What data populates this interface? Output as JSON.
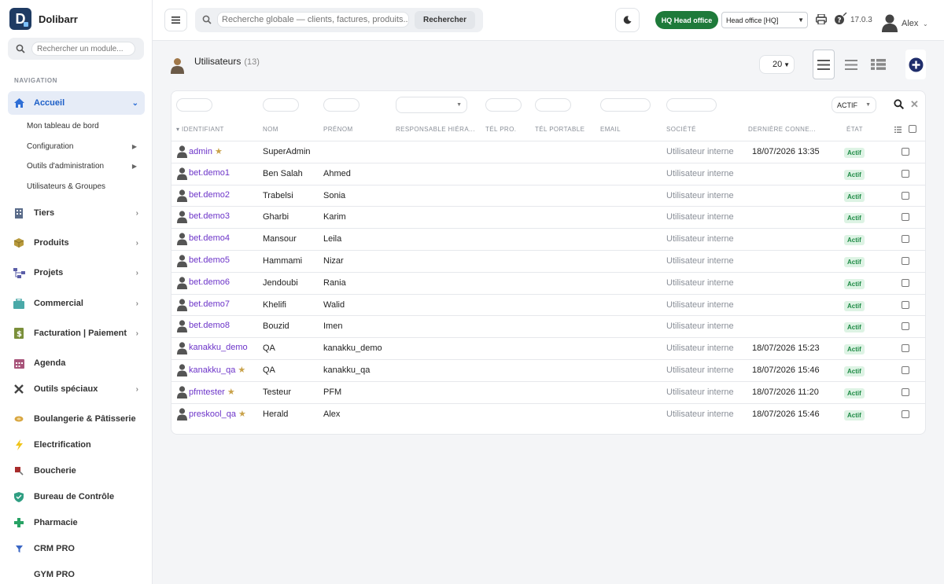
{
  "app": {
    "name": "Dolibarr"
  },
  "sidebar": {
    "search_placeholder": "Rechercher un module...",
    "nav_title": "NAVIGATION",
    "items": [
      {
        "label": "Accueil",
        "icon": "home-icon"
      },
      {
        "label": "Tiers",
        "icon": "building-icon"
      },
      {
        "label": "Produits",
        "icon": "box-icon"
      },
      {
        "label": "Projets",
        "icon": "project-icon"
      },
      {
        "label": "Commercial",
        "icon": "briefcase-icon"
      },
      {
        "label": "Facturation | Paiement",
        "icon": "invoice-icon"
      },
      {
        "label": "Agenda",
        "icon": "calendar-icon"
      },
      {
        "label": "Outils spéciaux",
        "icon": "tools-icon"
      },
      {
        "label": "Boulangerie & Pâtisserie",
        "icon": "bread-icon"
      },
      {
        "label": "Electrification",
        "icon": "lightning-icon"
      },
      {
        "label": "Boucherie",
        "icon": "meat-icon"
      },
      {
        "label": "Bureau de Contrôle",
        "icon": "shield-icon"
      },
      {
        "label": "Pharmacie",
        "icon": "cross-icon"
      },
      {
        "label": "CRM PRO",
        "icon": "funnel-icon"
      },
      {
        "label": "GYM PRO",
        "icon": "gym-icon"
      }
    ],
    "subitems": [
      {
        "label": "Mon tableau de bord"
      },
      {
        "label": "Configuration"
      },
      {
        "label": "Outils d'administration"
      },
      {
        "label": "Utilisateurs & Groupes"
      }
    ]
  },
  "topbar": {
    "search_placeholder": "Recherche globale — clients, factures, produits...",
    "search_button": "Rechercher",
    "entity_badge": "HQ Head office",
    "entity_select": "Head office [HQ]",
    "version": "17.0.3",
    "user": "Alex"
  },
  "page": {
    "title": "Utilisateurs",
    "count": "(13)",
    "limit": "20",
    "status_filter": "ACTIF"
  },
  "table": {
    "columns": [
      "IDENTIFIANT",
      "NOM",
      "PRÉNOM",
      "RESPONSABLE HIÉRA...",
      "TÉL PRO.",
      "TÉL PORTABLE",
      "EMAIL",
      "SOCIÉTÉ",
      "DERNIÈRE CONNE...",
      "ÉTAT"
    ],
    "rows": [
      {
        "login": "admin",
        "star": "★",
        "nom": "SuperAdmin",
        "prenom": "",
        "societe": "Utilisateur interne",
        "last": "18/07/2026 13:35",
        "etat": "Actif"
      },
      {
        "login": "bet.demo1",
        "star": "",
        "nom": "Ben Salah",
        "prenom": "Ahmed",
        "societe": "Utilisateur interne",
        "last": "",
        "etat": "Actif"
      },
      {
        "login": "bet.demo2",
        "star": "",
        "nom": "Trabelsi",
        "prenom": "Sonia",
        "societe": "Utilisateur interne",
        "last": "",
        "etat": "Actif"
      },
      {
        "login": "bet.demo3",
        "star": "",
        "nom": "Gharbi",
        "prenom": "Karim",
        "societe": "Utilisateur interne",
        "last": "",
        "etat": "Actif"
      },
      {
        "login": "bet.demo4",
        "star": "",
        "nom": "Mansour",
        "prenom": "Leila",
        "societe": "Utilisateur interne",
        "last": "",
        "etat": "Actif"
      },
      {
        "login": "bet.demo5",
        "star": "",
        "nom": "Hammami",
        "prenom": "Nizar",
        "societe": "Utilisateur interne",
        "last": "",
        "etat": "Actif"
      },
      {
        "login": "bet.demo6",
        "star": "",
        "nom": "Jendoubi",
        "prenom": "Rania",
        "societe": "Utilisateur interne",
        "last": "",
        "etat": "Actif"
      },
      {
        "login": "bet.demo7",
        "star": "",
        "nom": "Khelifi",
        "prenom": "Walid",
        "societe": "Utilisateur interne",
        "last": "",
        "etat": "Actif"
      },
      {
        "login": "bet.demo8",
        "star": "",
        "nom": "Bouzid",
        "prenom": "Imen",
        "societe": "Utilisateur interne",
        "last": "",
        "etat": "Actif"
      },
      {
        "login": "kanakku_demo",
        "star": "",
        "nom": "QA",
        "prenom": "kanakku_demo",
        "societe": "Utilisateur interne",
        "last": "18/07/2026 15:23",
        "etat": "Actif"
      },
      {
        "login": "kanakku_qa",
        "star": "★",
        "nom": "QA",
        "prenom": "kanakku_qa",
        "societe": "Utilisateur interne",
        "last": "18/07/2026 15:46",
        "etat": "Actif"
      },
      {
        "login": "pfmtester",
        "star": "★",
        "nom": "Testeur",
        "prenom": "PFM",
        "societe": "Utilisateur interne",
        "last": "18/07/2026 11:20",
        "etat": "Actif"
      },
      {
        "login": "preskool_qa",
        "star": "★",
        "nom": "Herald",
        "prenom": "Alex",
        "societe": "Utilisateur interne",
        "last": "18/07/2026 15:46",
        "etat": "Actif"
      }
    ]
  }
}
